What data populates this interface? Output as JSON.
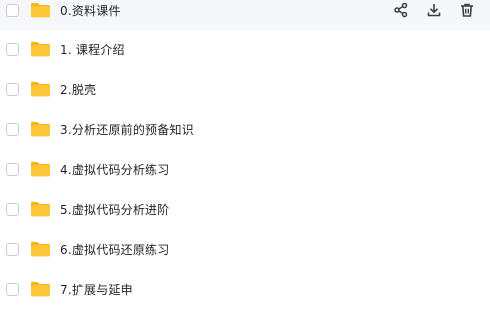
{
  "file_list": {
    "items": [
      {
        "name": "0.资料课件"
      },
      {
        "name": "1. 课程介绍"
      },
      {
        "name": "2.脱壳"
      },
      {
        "name": "3.分析还原前的预备知识"
      },
      {
        "name": "4.虚拟代码分析练习"
      },
      {
        "name": "5.虚拟代码分析进阶"
      },
      {
        "name": "6.虚拟代码还原练习"
      },
      {
        "name": "7.扩展与延申"
      }
    ],
    "row_actions": [
      "share-icon",
      "download-icon",
      "delete-icon"
    ]
  },
  "colors": {
    "folder_body": "#fdc93b",
    "folder_tab": "#f6b61f",
    "hover_row": "#f6f7fb",
    "text": "#1f2329",
    "icon": "#3c3f46"
  }
}
